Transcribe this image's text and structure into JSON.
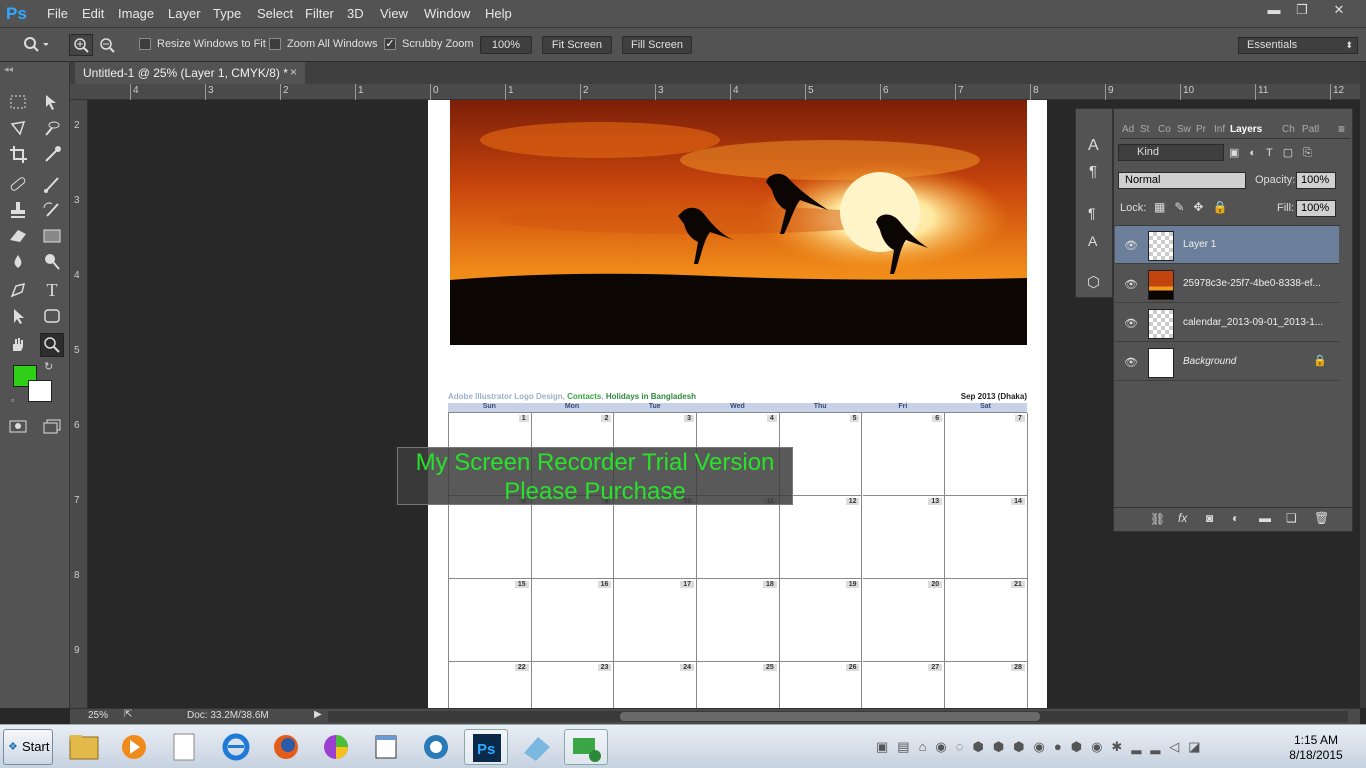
{
  "app": {
    "logo": "Ps"
  },
  "menu": [
    "File",
    "Edit",
    "Image",
    "Layer",
    "Type",
    "Select",
    "Filter",
    "3D",
    "View",
    "Window",
    "Help"
  ],
  "window_buttons": {
    "minimize": "▬",
    "restore": "❐",
    "close": "✕"
  },
  "options": {
    "resize_windows": "Resize Windows to Fit",
    "zoom_all": "Zoom All Windows",
    "scrubby": "Scrubby Zoom",
    "zoom_value": "100%",
    "fit_screen": "Fit Screen",
    "fill_screen": "Fill Screen",
    "workspace": "Essentials"
  },
  "document_tab": {
    "title": "Untitled-1 @ 25% (Layer 1, CMYK/8) *",
    "close": "×"
  },
  "rulers": {
    "h": [
      "4",
      "3",
      "2",
      "1",
      "0",
      "1",
      "2",
      "3",
      "4",
      "5",
      "6",
      "7",
      "8",
      "9",
      "10",
      "11",
      "12"
    ],
    "v": [
      "2",
      "3",
      "4",
      "5",
      "6",
      "7",
      "8",
      "9"
    ]
  },
  "calendar": {
    "header_left_1": "Adobe Illustrator Logo Design",
    "header_sep1": ", ",
    "header_left_2": "Contacts",
    "header_sep2": ", ",
    "header_left_3": "Holidays in Bangladesh",
    "header_right": "Sep 2013 (Dhaka)",
    "days": [
      "Sun",
      "Mon",
      "Tue",
      "Wed",
      "Thu",
      "Fri",
      "Sat"
    ],
    "numbers": [
      "1",
      "2",
      "3",
      "4",
      "5",
      "6",
      "7",
      "8",
      "9",
      "10",
      "11",
      "12",
      "13",
      "14",
      "15",
      "16",
      "17",
      "18",
      "19",
      "20",
      "21",
      "22",
      "23",
      "24",
      "25",
      "26",
      "27",
      "28"
    ]
  },
  "watermark": {
    "line1": "My Screen Recorder Trial Version",
    "line2": "Please Purchase"
  },
  "status": {
    "zoom": "25%",
    "doc": "Doc: 33.2M/38.6M"
  },
  "panel_tabs": [
    "Ad",
    "St",
    "Co",
    "Sw",
    "Pr",
    "Inf",
    "Layers",
    "Ch",
    "Patl"
  ],
  "layers_panel": {
    "filter": "Kind",
    "blend": "Normal",
    "opacity_label": "Opacity:",
    "opacity": "100%",
    "lock_label": "Lock:",
    "fill_label": "Fill:",
    "fill": "100%",
    "layers": [
      {
        "name": "Layer 1",
        "selected": true
      },
      {
        "name": "25978c3e-25f7-4be0-8338-ef...",
        "selected": false
      },
      {
        "name": "calendar_2013-09-01_2013-1...",
        "selected": false
      },
      {
        "name": "Background",
        "selected": false
      }
    ]
  },
  "taskbar": {
    "start": "Start",
    "time": "1:15 AM",
    "date": "8/18/2015"
  },
  "colors": {
    "foreground": "#2fcf17",
    "background": "#ffffff",
    "accent": "#31a8ff"
  }
}
